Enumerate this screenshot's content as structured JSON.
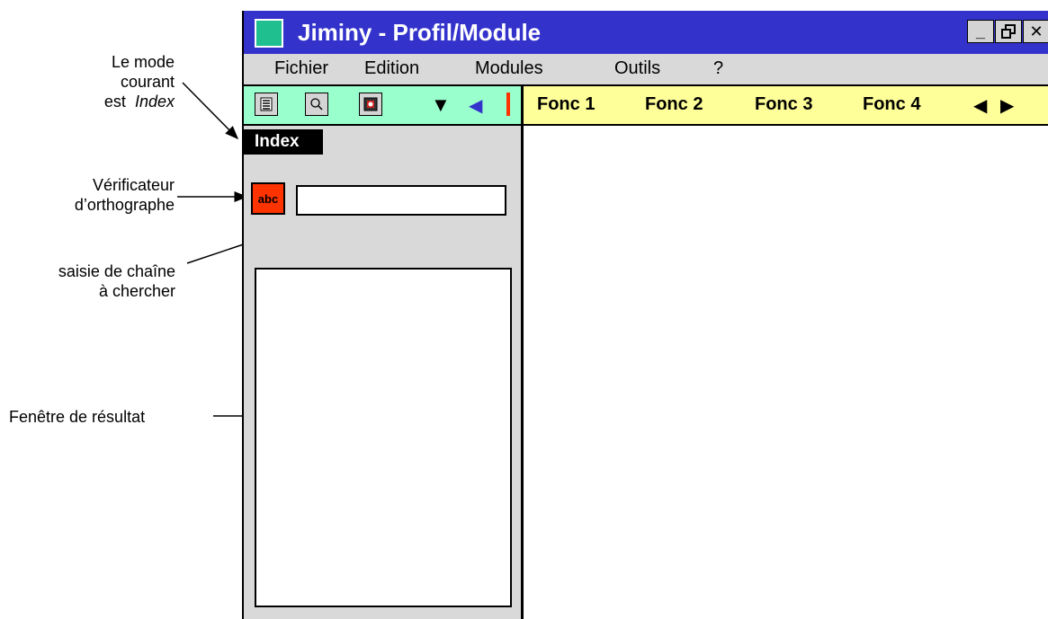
{
  "annotations": {
    "mode_line1": "Le mode",
    "mode_line2": "courant",
    "mode_line3a": "est",
    "mode_line3b": "Index",
    "spell_line1": "Vérificateur",
    "spell_line2": "d’orthographe",
    "search_line1": "saisie de chaîne",
    "search_line2": "à chercher",
    "result": "Fenêtre de résultat"
  },
  "window": {
    "title": "Jiminy - Profil/Module",
    "buttons": {
      "minimize": "_",
      "restore": "🗗",
      "close": "✕"
    }
  },
  "menu": [
    "Fichier",
    "Edition",
    "Modules",
    "Outils",
    "?"
  ],
  "toolbar": {
    "icons": [
      "list-icon",
      "search-icon",
      "image-icon"
    ],
    "dropdown_glyph": "▼",
    "collapse_glyph": "◀"
  },
  "functions": {
    "items": [
      "Fonc 1",
      "Fonc 2",
      "Fonc 3",
      "Fonc 4"
    ],
    "prev_glyph": "◀",
    "next_glyph": "▶"
  },
  "panel": {
    "mode": "Index",
    "spell_button": "abc",
    "search_value": ""
  },
  "colors": {
    "titlebar": "#3333cc",
    "app_icon": "#1fbf8f",
    "toolbar": "#99ffcc",
    "function_bar": "#ffff99",
    "accent": "#ff3300",
    "panel": "#d9d9d9"
  }
}
